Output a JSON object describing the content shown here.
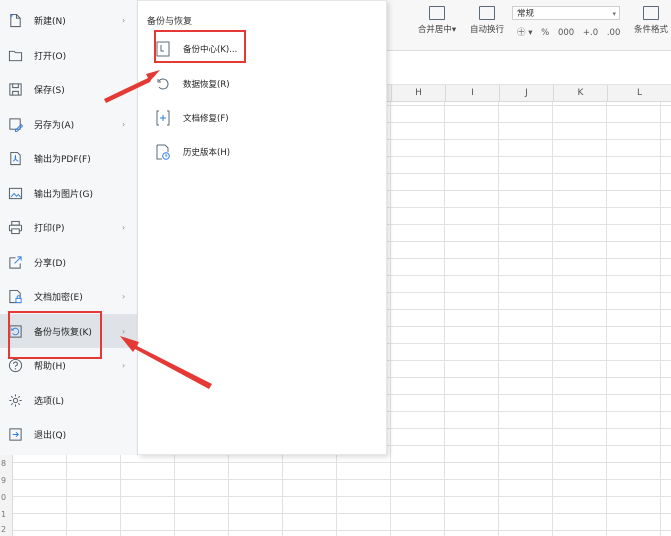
{
  "ribbon": {
    "merge_label": "合并居中",
    "merge_arrow": "▾",
    "wrap_label": "自动换行",
    "number_format": "常规",
    "number_buttons": [
      "㊉ ▾",
      "%",
      "000",
      "+.0",
      ".00"
    ],
    "cond_format_label": "条件格式"
  },
  "columns": [
    "H",
    "I",
    "J",
    "K",
    "L"
  ],
  "row_numbers": [
    "8",
    "9",
    "0",
    "1",
    "2"
  ],
  "menu": {
    "items": [
      {
        "label": "新建(N)",
        "icon": "new-file-icon",
        "has_submenu": true
      },
      {
        "label": "打开(O)",
        "icon": "folder-open-icon",
        "has_submenu": false
      },
      {
        "label": "保存(S)",
        "icon": "save-icon",
        "has_submenu": false
      },
      {
        "label": "另存为(A)",
        "icon": "save-as-icon",
        "has_submenu": true
      },
      {
        "label": "输出为PDF(F)",
        "icon": "pdf-icon",
        "has_submenu": false
      },
      {
        "label": "输出为图片(G)",
        "icon": "image-export-icon",
        "has_submenu": false
      },
      {
        "label": "打印(P)",
        "icon": "print-icon",
        "has_submenu": true
      },
      {
        "label": "分享(D)",
        "icon": "share-icon",
        "has_submenu": false
      },
      {
        "label": "文档加密(E)",
        "icon": "encrypt-icon",
        "has_submenu": true
      },
      {
        "label": "备份与恢复(K)",
        "icon": "backup-icon",
        "has_submenu": true,
        "active": true
      },
      {
        "label": "帮助(H)",
        "icon": "help-icon",
        "has_submenu": true
      },
      {
        "label": "选项(L)",
        "icon": "gear-icon",
        "has_submenu": false
      },
      {
        "label": "退出(Q)",
        "icon": "exit-icon",
        "has_submenu": false
      }
    ],
    "arrow": "›"
  },
  "submenu": {
    "title": "备份与恢复",
    "items": [
      {
        "label": "备份中心(K)...",
        "icon": "backup-center-icon"
      },
      {
        "label": "数据恢复(R)",
        "icon": "data-recovery-icon"
      },
      {
        "label": "文档修复(F)",
        "icon": "doc-repair-icon"
      },
      {
        "label": "历史版本(H)",
        "icon": "history-version-icon"
      }
    ]
  },
  "colors": {
    "annotation_red": "#e53935",
    "menu_bg": "#f6f7f9",
    "menu_active_bg": "#dfe3e8"
  }
}
